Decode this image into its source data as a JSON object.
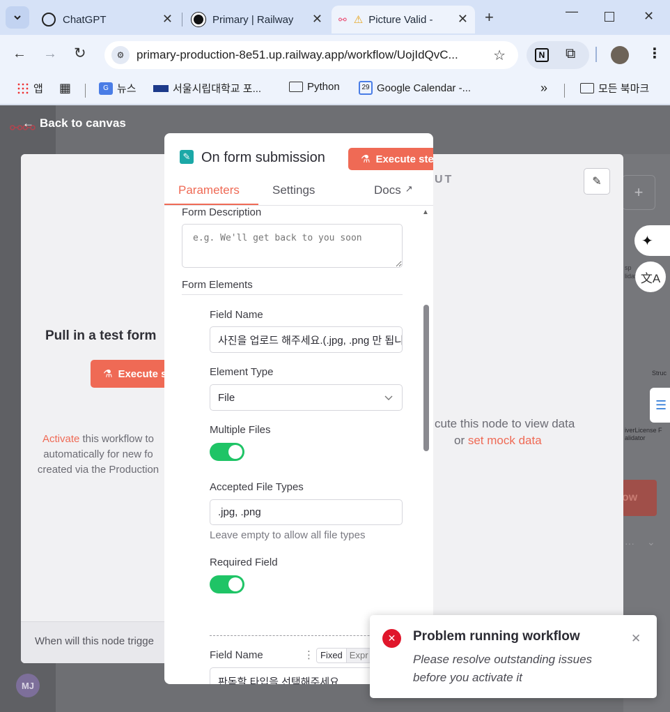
{
  "browser": {
    "tabs": [
      {
        "title": "ChatGPT",
        "icon": "chatgpt-icon"
      },
      {
        "title": "Primary | Railway",
        "icon": "railway-icon"
      },
      {
        "title": "Picture Valid -",
        "icon": "n8n-icon",
        "warning": "warning-icon"
      }
    ],
    "url": "primary-production-8e51.up.railway.app/workflow/UojIdQvC...",
    "bookmarks": [
      {
        "label": "앱",
        "icon": "apps-grid-icon"
      },
      {
        "label": "",
        "icon": "grid-icon"
      },
      {
        "label": "뉴스",
        "icon": "google-news-icon"
      },
      {
        "label": "서울시립대학교 포...",
        "icon": "uos-icon"
      },
      {
        "label": "Python",
        "icon": "folder-icon"
      },
      {
        "label": "Google Calendar -...",
        "icon": "calendar-icon",
        "badge": "29"
      },
      {
        "label": "모든 북마크",
        "icon": "folder-icon"
      }
    ],
    "more_bookmarks": "»"
  },
  "canvas": {
    "back_label": "Back to canvas",
    "input_pane": {
      "heading": "Pull in a test form",
      "execute_label": "Execute s",
      "activate_link": "Activate",
      "activate_rest_1": " this workflow to",
      "activate_rest_2": "automatically for new fo",
      "activate_rest_3": "created via the Production",
      "footer": "When will this node trigge"
    },
    "output_pane": {
      "header": "UT",
      "hint": "cute this node to view data",
      "or_text": "or ",
      "mock_link": "set mock data"
    },
    "background_nodes": [
      "sp",
      "lidat",
      "Struc",
      "iverLicense F",
      "alidator",
      "ow"
    ],
    "avatar": "MJ"
  },
  "node_panel": {
    "title": "On form submission",
    "execute_label": "Execute ste",
    "tabs": {
      "parameters": "Parameters",
      "settings": "Settings",
      "docs": "Docs"
    },
    "form_description": {
      "label": "Form Description",
      "placeholder": "e.g. We'll get back to you soon"
    },
    "form_elements_label": "Form Elements",
    "element1": {
      "field_name_label": "Field Name",
      "field_name_value": "사진을 업로드 해주세요.(.jpg, .png 만 됩니",
      "element_type_label": "Element Type",
      "element_type_value": "File",
      "multiple_files_label": "Multiple Files",
      "multiple_files_on": true,
      "accepted_types_label": "Accepted File Types",
      "accepted_types_value": ".jpg, .png",
      "accepted_types_hint": "Leave empty to allow all file types",
      "required_label": "Required Field",
      "required_on": true
    },
    "element2": {
      "field_name_label": "Field Name",
      "fixed_label": "Fixed",
      "expression_label": "Expr",
      "field_name_value": "판독할 타입을 선택해주세요"
    }
  },
  "toast": {
    "title": "Problem running workflow",
    "message_1": "Please resolve outstanding issues",
    "message_2": "before you activate it"
  },
  "colors": {
    "accent": "#ef6a55",
    "toggle": "#1fc466",
    "error": "#e0162b"
  }
}
